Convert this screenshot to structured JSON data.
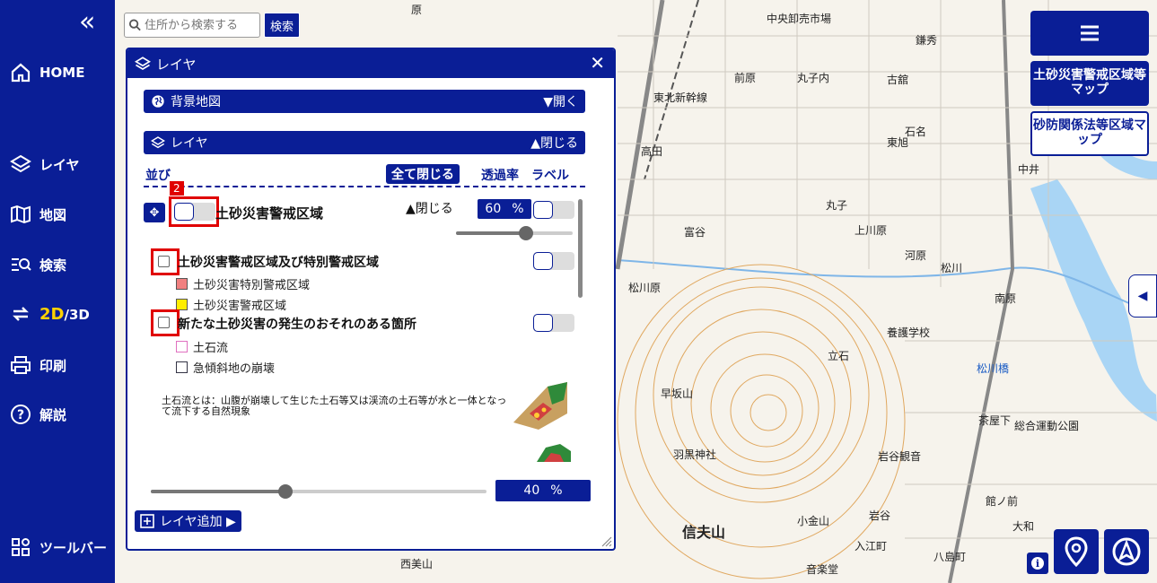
{
  "sidebar": {
    "collapse": "«",
    "items": [
      {
        "label": "HOME"
      },
      {
        "label": "レイヤ"
      },
      {
        "label": "地図"
      },
      {
        "label": "検索"
      },
      {
        "label_2d": "2D",
        "label_3d": "/3D"
      },
      {
        "label": "印刷"
      },
      {
        "label": "解説"
      },
      {
        "label": "ツールバー"
      }
    ]
  },
  "search": {
    "placeholder": "住所から検索する",
    "button": "検索"
  },
  "panel": {
    "title": "レイヤ",
    "close": "✕",
    "background_section": {
      "label": "背景地図",
      "toggle": "▼開く"
    },
    "layer_section": {
      "label": "レイヤ",
      "toggle": "▲閉じる"
    },
    "sort_label": "並び",
    "close_all": "全て閉じる",
    "opacity_header": "透過率",
    "label_header": "ラベル",
    "badge": "2",
    "main_layer": {
      "title": "土砂災害警戒区域",
      "collapse": "▲閉じる",
      "opacity_value": "60",
      "opacity_unit": "%",
      "slider_level": 0.6
    },
    "sublayers": [
      {
        "title": "土砂災害警戒区域及び特別警戒区域",
        "legend": [
          {
            "label": "土砂災害特別警戒区域",
            "color": "#f08080"
          },
          {
            "label": "土砂災害警戒区域",
            "color": "#ffee00"
          }
        ]
      },
      {
        "title": "新たな土砂災害の発生のおそれのある箇所",
        "legend": [
          {
            "label": "土石流",
            "color": "#ffffff"
          },
          {
            "label": "急傾斜地の崩壊",
            "color": "#ffffff"
          }
        ]
      }
    ],
    "description": "土石流とは：山腹が崩壊して生じた土石等又は渓流の土石等が水と一体となって流下する自然現象",
    "bottom_opacity": {
      "value": "40",
      "unit": "%",
      "slider_level": 0.4
    },
    "add_layer": "レイヤ追加 ▶"
  },
  "right": {
    "map_btn_1": "土砂災害警戒区域等マップ",
    "map_btn_2": "砂防関係法等区域マップ",
    "side_tab": "◀",
    "info": "i"
  },
  "map_labels": [
    "中央卸売市場",
    "鎌秀",
    "古舘",
    "東北新幹線",
    "前原",
    "丸子内",
    "高田",
    "石名",
    "東旭",
    "丸子",
    "上川原",
    "河原",
    "松川",
    "富谷",
    "松川原",
    "養護学校",
    "立石",
    "松川橋",
    "早坂山",
    "茶屋下",
    "総合運動公園",
    "羽黒神社",
    "岩谷観音",
    "信夫山",
    "小金山",
    "岩谷",
    "入江町",
    "八島町",
    "音楽堂",
    "西美山",
    "館ノ前",
    "南原",
    "中井",
    "大和",
    "原"
  ],
  "colors": {
    "brand": "#0a1e96",
    "alert": "#e00000",
    "accent": "#ffd200"
  }
}
